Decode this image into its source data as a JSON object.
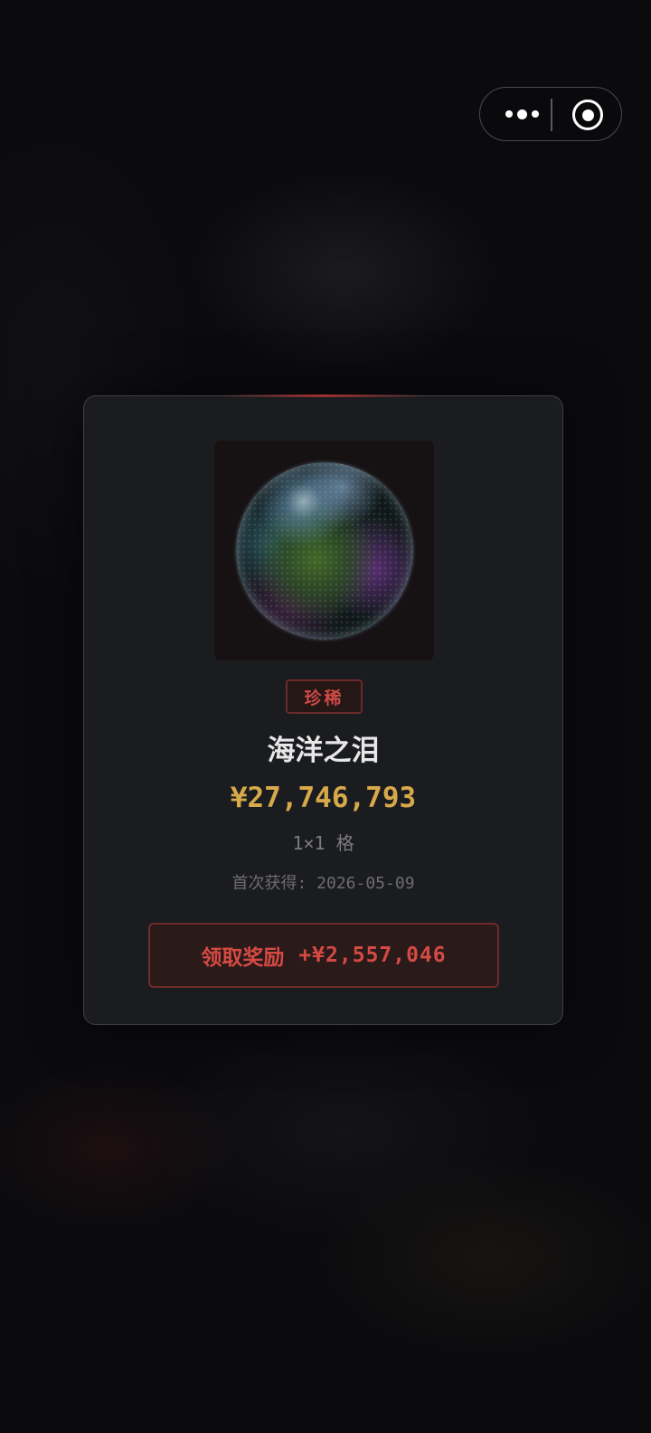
{
  "capsule": {
    "more_icon": "more-dots-icon",
    "close_icon": "target-close-icon"
  },
  "item": {
    "rarity": "珍稀",
    "name": "海洋之泪",
    "price": "¥27,746,793",
    "size": "1×1 格",
    "acquired_label": "首次获得:",
    "acquired_date": "2026-05-09",
    "image_icon": "iridescent-orb"
  },
  "claim": {
    "label": "领取奖励",
    "amount": "+¥2,557,046"
  },
  "colors": {
    "rarity": "#d04a44",
    "price": "#d6a94a",
    "card_bg": "#1b1c1f",
    "page_bg": "#0b0b0e"
  }
}
